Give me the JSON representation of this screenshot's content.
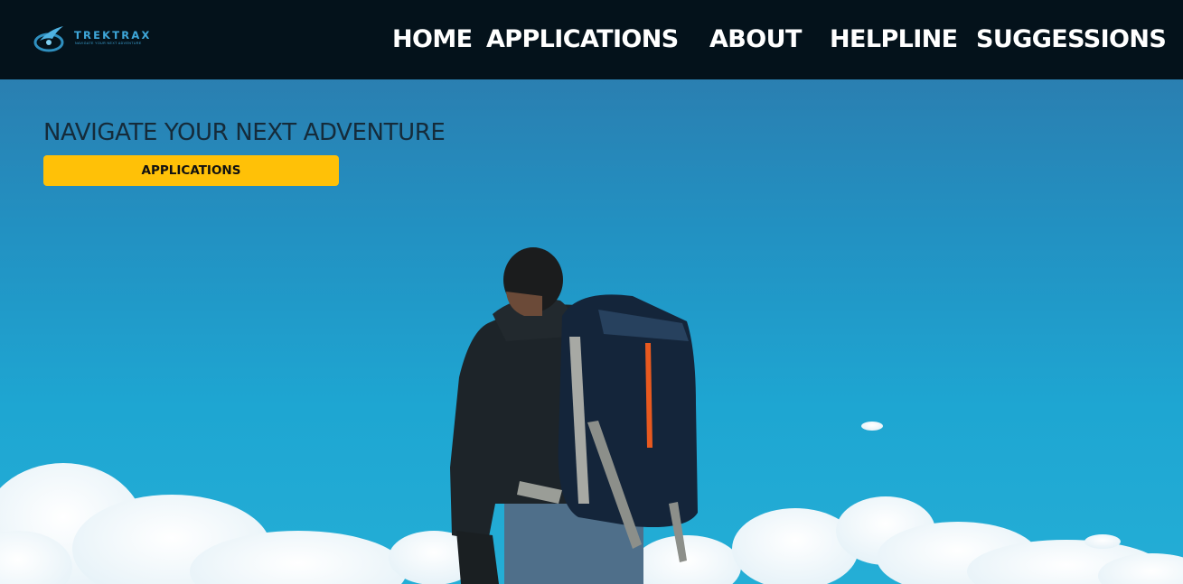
{
  "header": {
    "logo": {
      "name": "TREKTRAX",
      "tagline": "NAVIGATE YOUR NEXT ADVENTURE",
      "icon": "compass-bird-logo-icon"
    },
    "nav": [
      {
        "label": "HOME"
      },
      {
        "label": "APPLICATIONS"
      },
      {
        "label": "ABOUT"
      },
      {
        "label": "HELPLINE"
      },
      {
        "label": "SUGGESSIONS"
      }
    ]
  },
  "hero": {
    "title": "NAVIGATE YOUR NEXT ADVENTURE",
    "button_label": "APPLICATIONS",
    "image": "hiker-with-backpack-against-blue-sky"
  },
  "colors": {
    "header_bg": "#04121b",
    "accent": "#ffc107",
    "logo": "#3ea7da",
    "sky": "#1fa0cf"
  }
}
